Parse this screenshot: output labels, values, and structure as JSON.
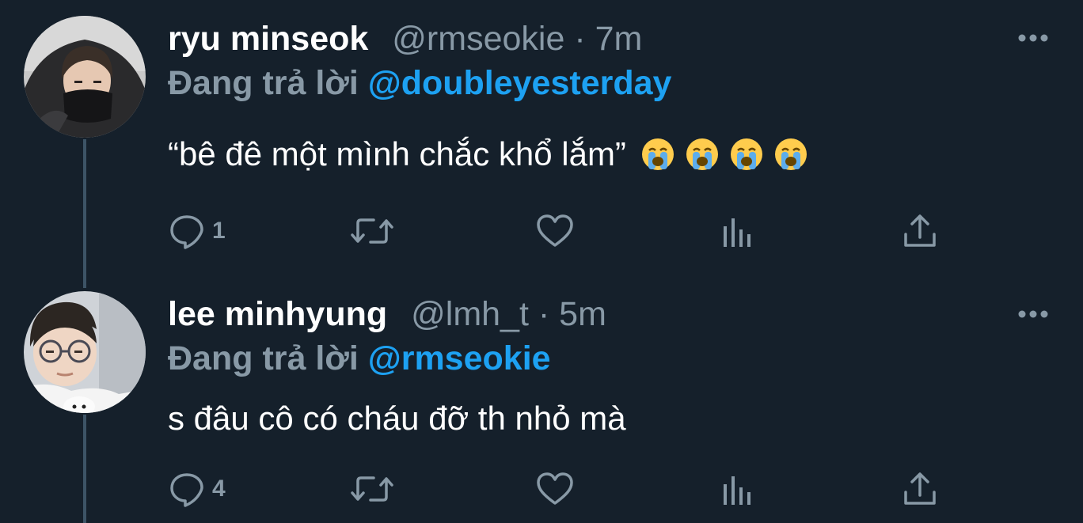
{
  "tweets": [
    {
      "display_name": "ryu minseok",
      "handle": "@rmseokie",
      "separator": "·",
      "time": "7m",
      "reply_label": "Đang trả lời",
      "reply_mention": "@doubleyesterday",
      "text": "“bê đê một mình chắc khổ lắm”",
      "emojis": [
        "loudly-crying-face",
        "loudly-crying-face",
        "loudly-crying-face",
        "loudly-crying-face"
      ],
      "reply_count": "1"
    },
    {
      "display_name": "lee minhyung",
      "handle": "@lmh_t",
      "separator": "·",
      "time": "5m",
      "reply_label": "Đang trả lời",
      "reply_mention": "@rmseokie",
      "text": "s đâu cô có cháu đỡ th nhỏ mà",
      "reply_count": "4"
    }
  ],
  "icons": {
    "reply": "comment-bubble-icon",
    "retweet": "retweet-icon",
    "like": "heart-icon",
    "analytics": "bar-chart-icon",
    "share": "share-upload-icon",
    "more": "more-dots-icon"
  },
  "colors": {
    "background": "#15202b",
    "primary_text": "#ffffff",
    "secondary_text": "#8899a6",
    "mention": "#1da1f2",
    "thread_line": "#3d5466"
  }
}
